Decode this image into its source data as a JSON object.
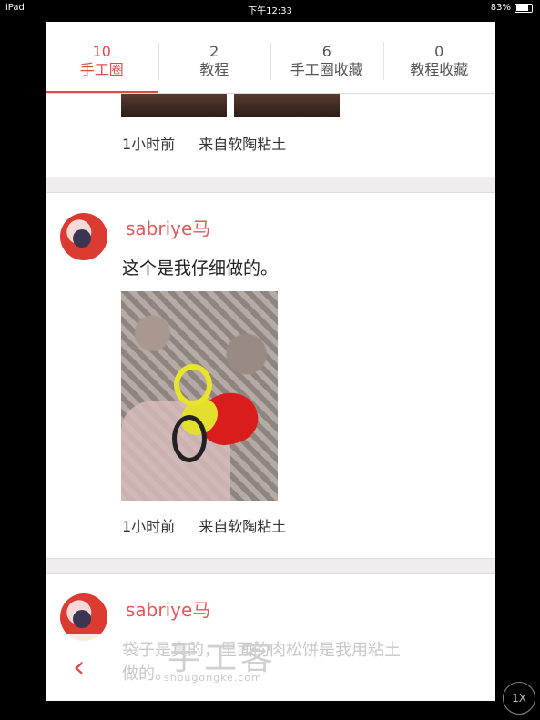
{
  "status_bar": {
    "device": "iPad",
    "time": "下午12:33",
    "battery": "83%"
  },
  "tabs": [
    {
      "count": "10",
      "label": "手工圈"
    },
    {
      "count": "2",
      "label": "教程"
    },
    {
      "count": "6",
      "label": "手工圈收藏"
    },
    {
      "count": "0",
      "label": "教程收藏"
    }
  ],
  "previous_post": {
    "time": "1小时前",
    "source": "来自软陶粘土"
  },
  "posts": [
    {
      "username": "sabriye马",
      "text": "这个是我仔细做的。",
      "time": "1小时前",
      "source": "来自软陶粘土"
    },
    {
      "username": "sabriye马",
      "text_line1": "袋子是真的，里面的肉松饼是我用粘土",
      "text_line2": "做的。"
    }
  ],
  "bottom_bar": {
    "back_icon": "chevron-left-icon"
  },
  "watermark": {
    "main": "手工客",
    "sub": "shougongke.com"
  },
  "zoom_button": "1X"
}
